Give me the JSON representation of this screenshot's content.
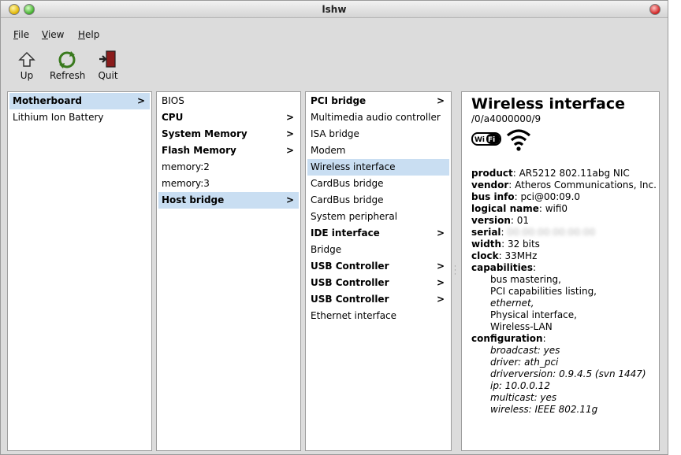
{
  "window": {
    "title": "lshw"
  },
  "menu": [
    {
      "accel": "F",
      "rest": "ile"
    },
    {
      "accel": "V",
      "rest": "iew"
    },
    {
      "accel": "H",
      "rest": "elp"
    }
  ],
  "toolbar": {
    "up": "Up",
    "refresh": "Refresh",
    "quit": "Quit"
  },
  "col1": [
    {
      "label": "Motherboard",
      "bold": true,
      "arrow": ">",
      "selected": true
    },
    {
      "label": "Lithium Ion Battery",
      "bold": false,
      "arrow": "",
      "selected": false
    }
  ],
  "col2": [
    {
      "label": "BIOS",
      "bold": false,
      "arrow": ""
    },
    {
      "label": "CPU",
      "bold": true,
      "arrow": ">"
    },
    {
      "label": "System Memory",
      "bold": true,
      "arrow": ">"
    },
    {
      "label": "Flash Memory",
      "bold": true,
      "arrow": ">"
    },
    {
      "label": "memory:2",
      "bold": false,
      "arrow": ""
    },
    {
      "label": "memory:3",
      "bold": false,
      "arrow": ""
    },
    {
      "label": "Host bridge",
      "bold": true,
      "arrow": ">",
      "selected": true
    }
  ],
  "col3": [
    {
      "label": "PCI bridge",
      "bold": true,
      "arrow": ">"
    },
    {
      "label": "Multimedia audio controller",
      "bold": false,
      "arrow": ""
    },
    {
      "label": "ISA bridge",
      "bold": false,
      "arrow": ""
    },
    {
      "label": "Modem",
      "bold": false,
      "arrow": ""
    },
    {
      "label": "Wireless interface",
      "bold": false,
      "arrow": "",
      "selected": true
    },
    {
      "label": "CardBus bridge",
      "bold": false,
      "arrow": ""
    },
    {
      "label": "CardBus bridge",
      "bold": false,
      "arrow": ""
    },
    {
      "label": "System peripheral",
      "bold": false,
      "arrow": ""
    },
    {
      "label": "IDE interface",
      "bold": true,
      "arrow": ">"
    },
    {
      "label": "Bridge",
      "bold": false,
      "arrow": ""
    },
    {
      "label": "USB Controller",
      "bold": true,
      "arrow": ">"
    },
    {
      "label": "USB Controller",
      "bold": true,
      "arrow": ">"
    },
    {
      "label": "USB Controller",
      "bold": true,
      "arrow": ">"
    },
    {
      "label": "Ethernet interface",
      "bold": false,
      "arrow": ""
    }
  ],
  "detail": {
    "title": "Wireless interface",
    "path": "/0/a4000000/9",
    "wifi_logo": "Wi Fi",
    "fields": [
      {
        "key": "product",
        "value": "AR5212 802.11abg NIC"
      },
      {
        "key": "vendor",
        "value": "Atheros Communications, Inc."
      },
      {
        "key": "bus info",
        "value": "pci@00:09.0"
      },
      {
        "key": "logical name",
        "value": "wifi0"
      },
      {
        "key": "version",
        "value": "01"
      },
      {
        "key": "serial",
        "value": "00:00:00:00:00:00",
        "blurred": true
      },
      {
        "key": "width",
        "value": "32 bits"
      },
      {
        "key": "clock",
        "value": "33MHz"
      }
    ],
    "capabilities_label": "capabilities",
    "capabilities": [
      {
        "text": "bus mastering,",
        "italic": false
      },
      {
        "text": "PCI capabilities listing,",
        "italic": false
      },
      {
        "text": "ethernet,",
        "italic": true
      },
      {
        "text": "Physical interface,",
        "italic": false
      },
      {
        "text": "Wireless-LAN",
        "italic": false
      }
    ],
    "configuration_label": "configuration",
    "configuration": [
      "broadcast: yes",
      "driver: ath_pci",
      "driverversion: 0.9.4.5 (svn 1447)",
      "ip: 10.0.0.12",
      "multicast: yes",
      "wireless: IEEE 802.11g"
    ]
  },
  "colors": {
    "selection": "#c9def2",
    "window_bg": "#dcdcdc"
  }
}
